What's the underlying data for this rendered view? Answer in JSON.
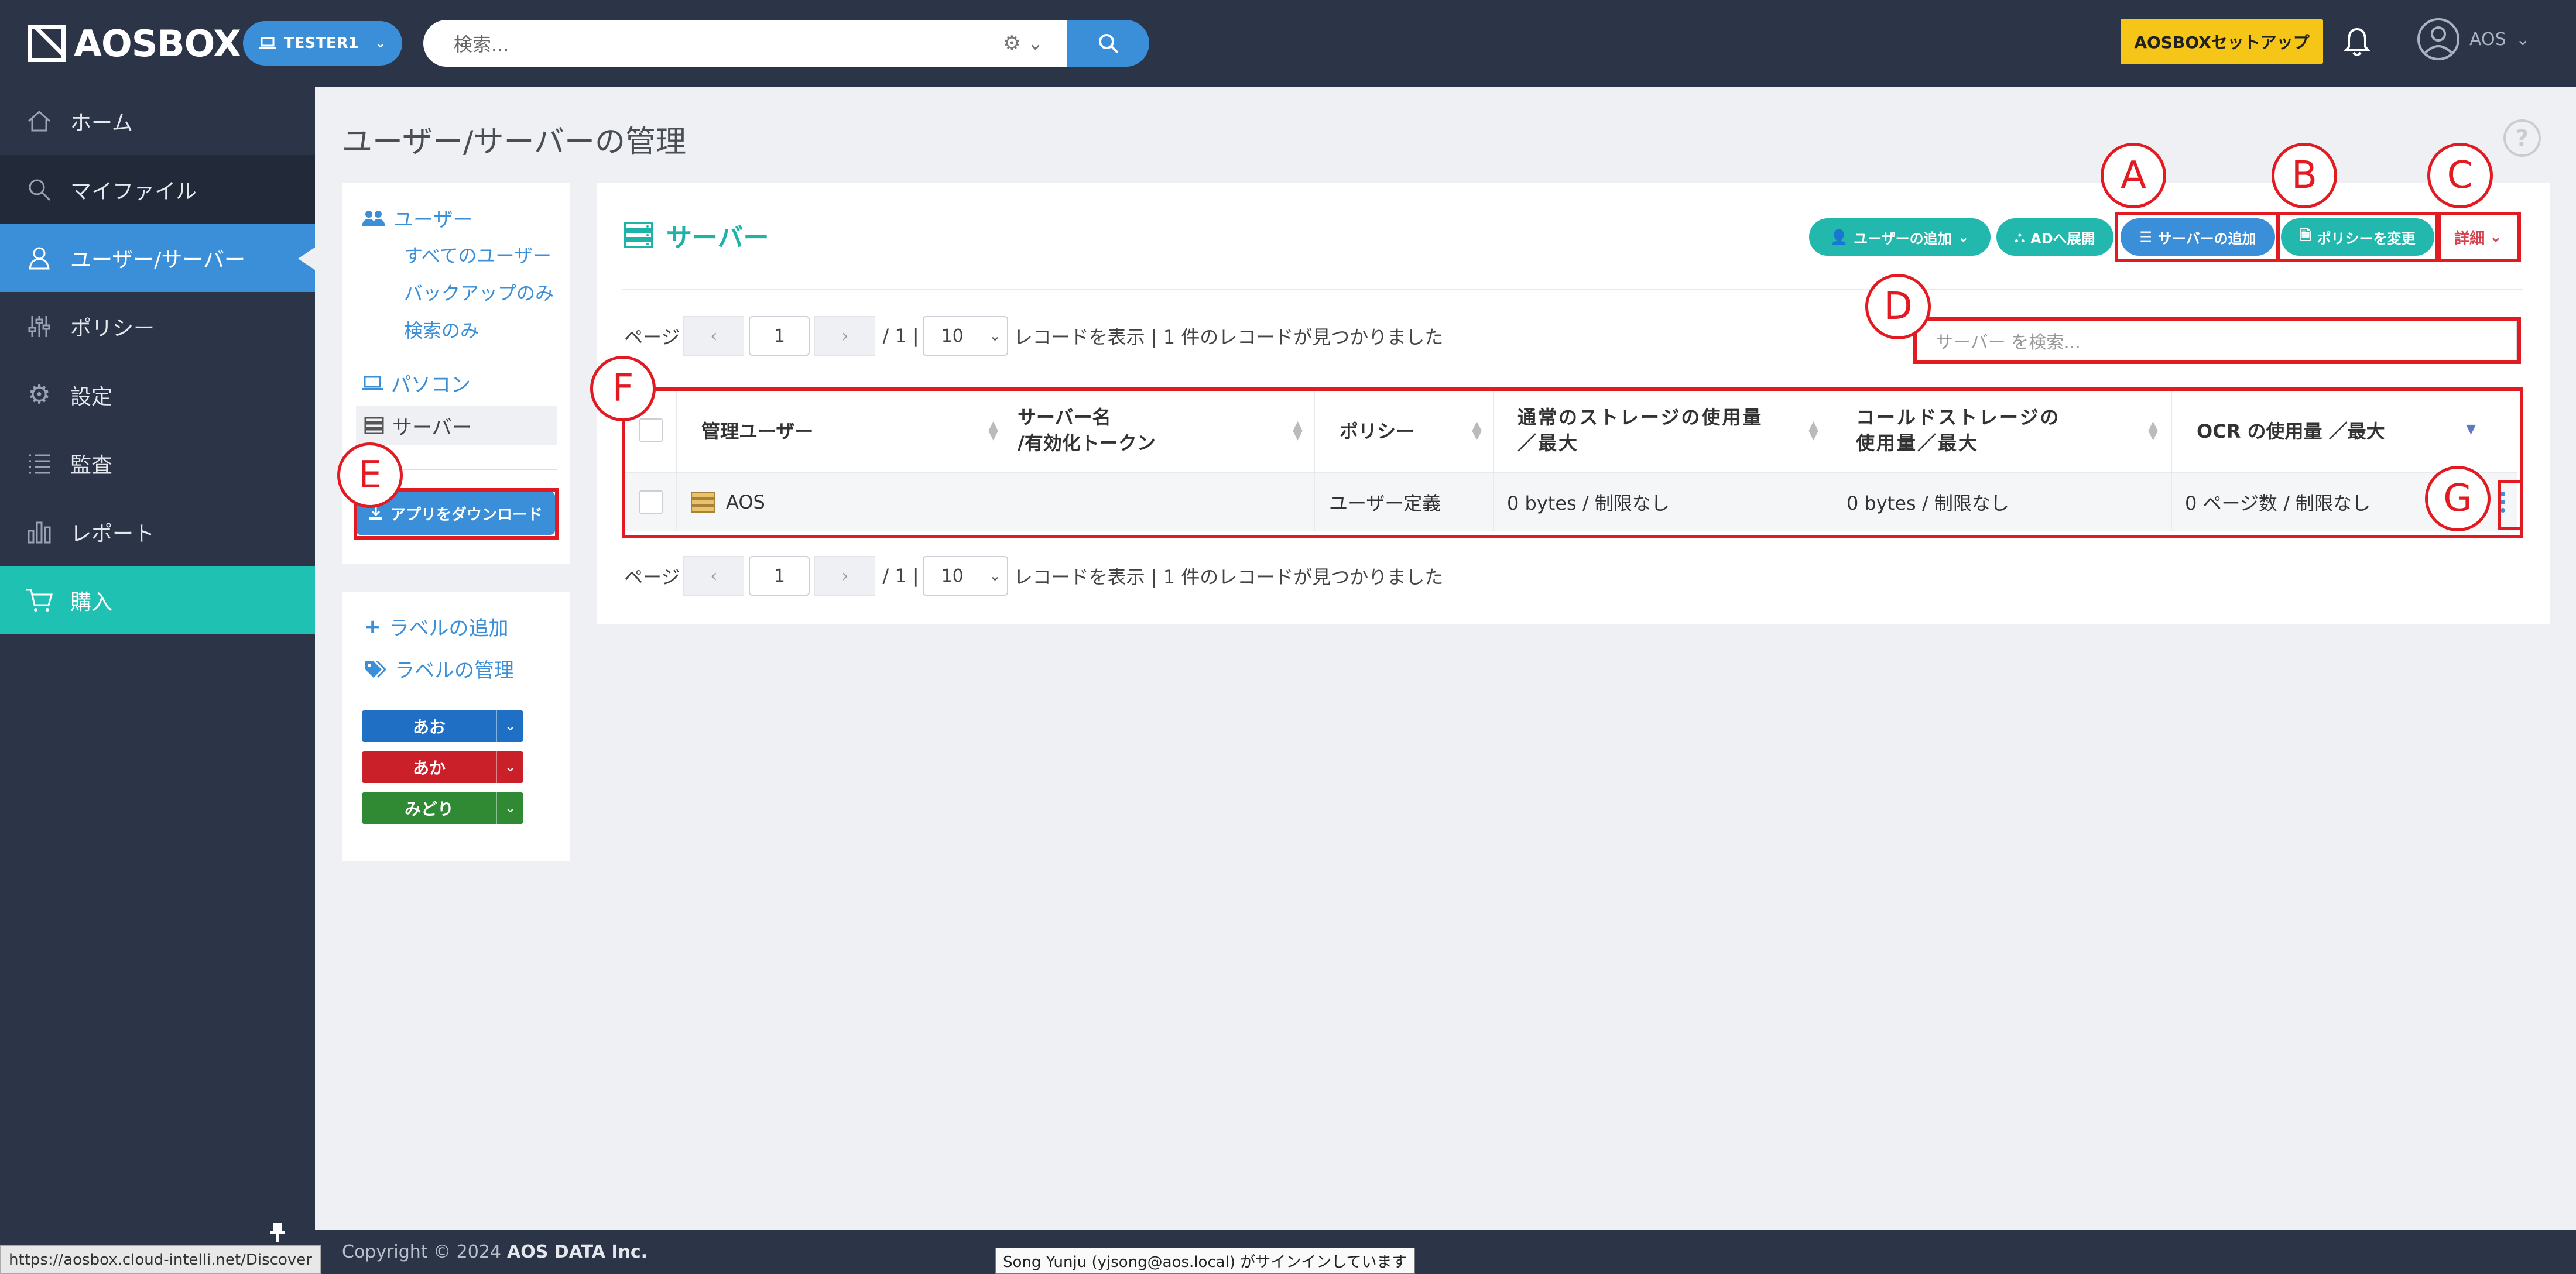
{
  "topbar": {
    "logo_text": "AOSBOX",
    "tenant_label": "TESTER1",
    "search_placeholder": "検索...",
    "setup_label": "AOSBOXセットアップ",
    "user_label": "AOS"
  },
  "sidebar": {
    "items": [
      {
        "label": "ホーム",
        "icon": "home-icon"
      },
      {
        "label": "マイファイル",
        "icon": "search-icon"
      },
      {
        "label": "ユーザー/サーバー",
        "icon": "user-icon"
      },
      {
        "label": "ポリシー",
        "icon": "sliders-icon"
      },
      {
        "label": "設定",
        "icon": "gear-icon"
      },
      {
        "label": "監査",
        "icon": "list-icon"
      },
      {
        "label": "レポート",
        "icon": "bar-chart-icon"
      },
      {
        "label": "購入",
        "icon": "cart-icon"
      }
    ]
  },
  "page": {
    "title": "ユーザー/サーバーの管理"
  },
  "left_panel": {
    "users_label": "ユーザー",
    "all_users": "すべてのユーザー",
    "backup_only": "バックアップのみ",
    "search_only": "検索のみ",
    "computers_label": "パソコン",
    "servers_label": "サーバー",
    "download_label": "アプリをダウンロード"
  },
  "labels_panel": {
    "add_label": "ラベルの追加",
    "manage_label": "ラベルの管理",
    "labels": [
      {
        "name": "あお",
        "color": "#1f6fc4"
      },
      {
        "name": "あか",
        "color": "#c9202a"
      },
      {
        "name": "みどり",
        "color": "#2f8a33"
      }
    ]
  },
  "main": {
    "title": "サーバー",
    "actions": {
      "add_user": "ユーザーの追加",
      "ad_deploy": "ADへ展開",
      "add_server": "サーバーの追加",
      "change_policy": "ポリシーを変更",
      "details": "詳細"
    },
    "search_placeholder": "サーバー を検索...",
    "pager": {
      "page_label": "ページ",
      "prev": "‹",
      "next": "›",
      "current_page": "1",
      "total_pages": "/ 1 |",
      "page_size": "10",
      "records_text": "レコードを表示 | 1 件のレコードが見つかりました"
    },
    "table": {
      "headers": {
        "admin_user": "管理ユーザー",
        "server_name_1": "サーバー名",
        "server_name_2": "/有効化トークン",
        "policy": "ポリシー",
        "storage_1": "通常のストレージの使用量",
        "storage_2": "／最大",
        "cold_1": "コールドストレージの",
        "cold_2": "使用量／最大",
        "ocr": "OCR の使用量 ／最大"
      },
      "rows": [
        {
          "admin_user": "AOS",
          "server_name": "",
          "policy": "ユーザー定義",
          "storage": "0 bytes / 制限なし",
          "cold": "0 bytes / 制限なし",
          "ocr": "0 ページ数 / 制限なし"
        }
      ]
    }
  },
  "annotations": {
    "a": "A",
    "b": "B",
    "c": "C",
    "d": "D",
    "e": "E",
    "f": "F",
    "g": "G"
  },
  "footer": {
    "copyright": "Copyright © 2024",
    "company": "AOS DATA Inc.",
    "signin_tip": "Song Yunju (yjsong@aos.local) がサインインしています",
    "status_url": "https://aosbox.cloud-intelli.net/Discover"
  }
}
